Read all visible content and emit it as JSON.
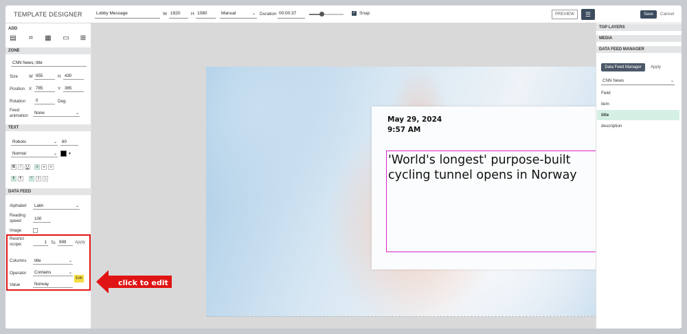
{
  "app": {
    "title": "TEMPLATE DESIGNER"
  },
  "toolbar": {
    "name_value": "Lobby Message",
    "w_label": "W",
    "w_value": "1920",
    "h_label": "H",
    "h_value": "1080",
    "mode_value": "Manual",
    "duration_label": "Duration",
    "duration_value": "00:00:37",
    "slider_value": 0.35,
    "snap_label": "Snap",
    "snap_checked": true,
    "preview_label": "PREVIEW",
    "save_label": "Save",
    "cancel_label": "Cancel"
  },
  "left": {
    "add_heading": "ADD",
    "add_icons": [
      "text-icon",
      "image-icon",
      "calendar-icon",
      "ticker-icon",
      "table-icon"
    ],
    "zone": {
      "heading": "ZONE",
      "name_value": "CNN News, title",
      "size_label": "Size",
      "w_label": "W",
      "w_value": "955",
      "h_label": "H",
      "h_value": "430",
      "position_label": "Position",
      "x_label": "X",
      "x_value": "785",
      "y_label": "Y",
      "y_value": "365",
      "rotation_label": "Rotation",
      "rotation_value": "0",
      "deg_label": "Deg.",
      "feed_anim_label": "Feed animation",
      "feed_anim_value": "None"
    },
    "text": {
      "heading": "TEXT",
      "font_value": "Roboto",
      "size_value": "60",
      "weight_value": "Normal",
      "color": "#000000"
    },
    "datafeed": {
      "heading": "DATA FEED",
      "alphabet_label": "Alphabet",
      "alphabet_value": "Latin",
      "reading_label": "Reading speed",
      "reading_value": "100",
      "image_label": "Image",
      "restrict_label": "Restrict scope:",
      "restrict_from": "1",
      "to_label": "To",
      "restrict_to": "999",
      "apply_label": "Apply",
      "columns_label": "Columns",
      "columns_value": "title",
      "operator_label": "Operator",
      "operator_value": "Contains",
      "value_label": "Value",
      "value_value": "Norway",
      "edit_label": "Edit"
    }
  },
  "callout": {
    "text": "click to edit",
    "color": "#e01414"
  },
  "canvas": {
    "date": "May 29, 2024",
    "time": "9:57 AM",
    "headline": "'World's longest' purpose-built cycling tunnel opens in Norway",
    "zone_border_color": "#e020c8"
  },
  "right": {
    "top_layers": "TOP LAYERS",
    "media": "MEDIA",
    "dfm_heading": "DATA FEED MANAGER",
    "dfm_button": "Data Feed Manager",
    "apply_label": "Apply",
    "feed_value": "CNN News",
    "fields": [
      {
        "label": "Field",
        "selected": false
      },
      {
        "label": "item",
        "selected": false
      },
      {
        "label": "title",
        "selected": true
      },
      {
        "label": "description",
        "selected": false
      }
    ]
  }
}
